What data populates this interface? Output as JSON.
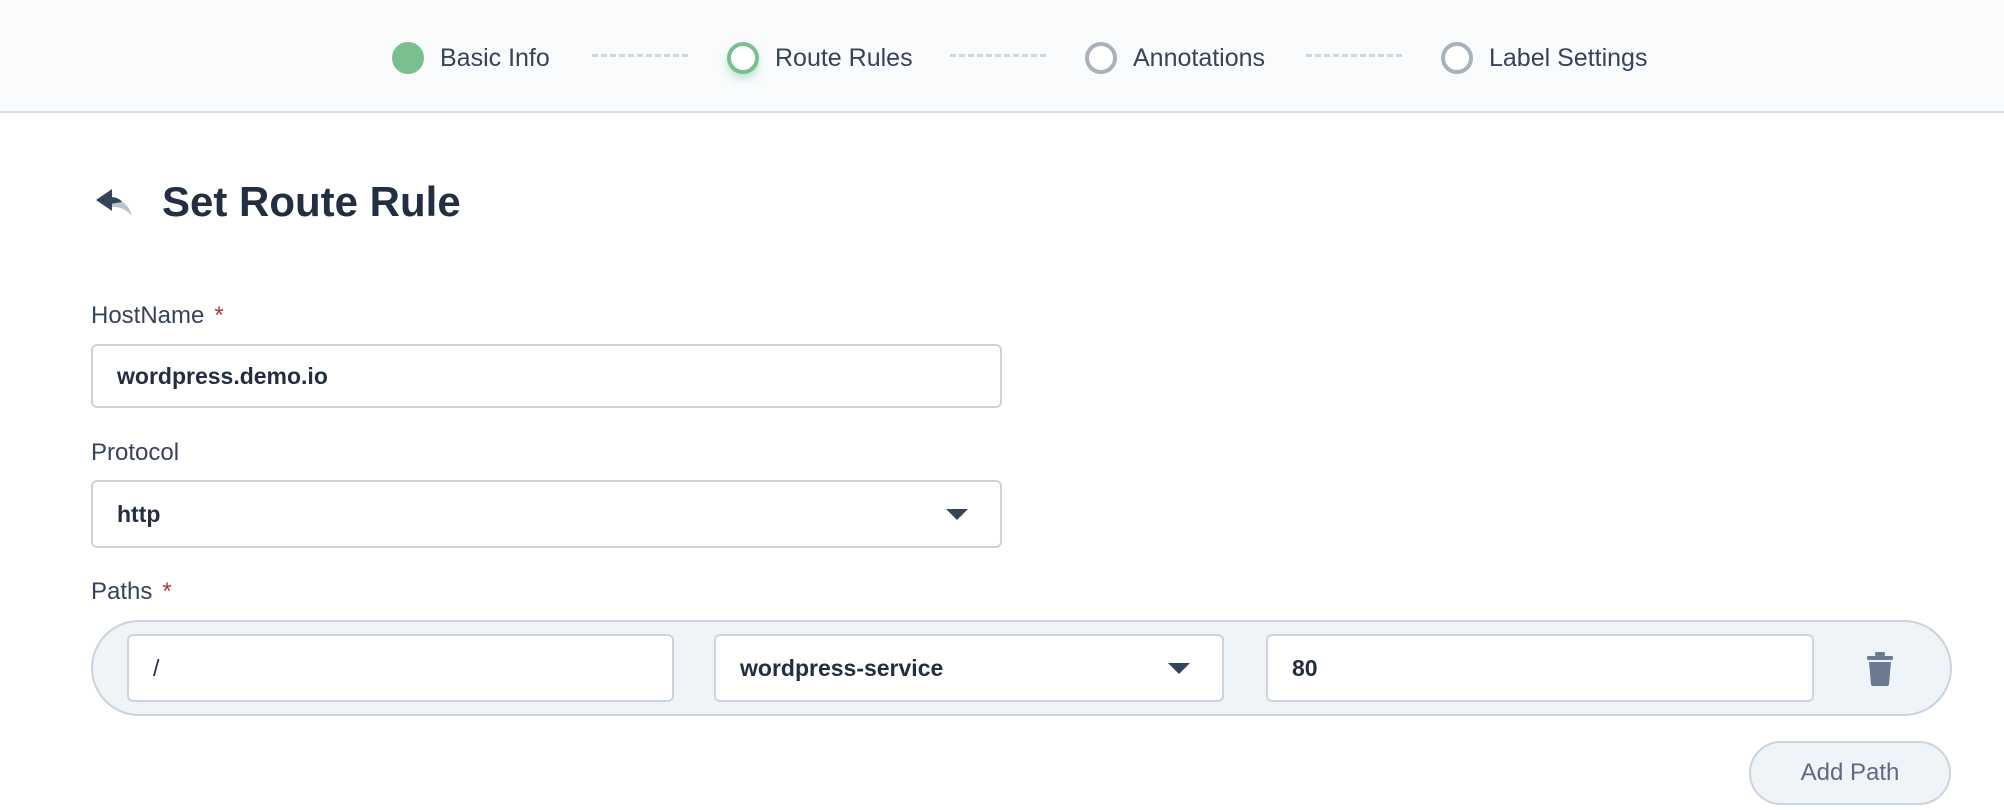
{
  "stepper": {
    "steps": [
      {
        "label": "Basic Info",
        "state": "done"
      },
      {
        "label": "Route Rules",
        "state": "active"
      },
      {
        "label": "Annotations",
        "state": "pending"
      },
      {
        "label": "Label Settings",
        "state": "pending"
      }
    ]
  },
  "title": {
    "text": "Set Route Rule",
    "back_icon": "back-arrow-icon"
  },
  "form": {
    "hostname": {
      "label": "HostName",
      "required_mark": "*",
      "value": "wordpress.demo.io"
    },
    "protocol": {
      "label": "Protocol",
      "value": "http"
    },
    "paths": {
      "label": "Paths",
      "required_mark": "*",
      "rows": [
        {
          "path": "/",
          "service": "wordpress-service",
          "port": "80",
          "delete_icon": "trash-icon"
        }
      ],
      "add_label": "Add Path"
    }
  },
  "colors": {
    "accent_green": "#7bbf8e",
    "text_dark": "#242e42",
    "border": "#ccd3db",
    "required_red": "#a33b3b"
  }
}
